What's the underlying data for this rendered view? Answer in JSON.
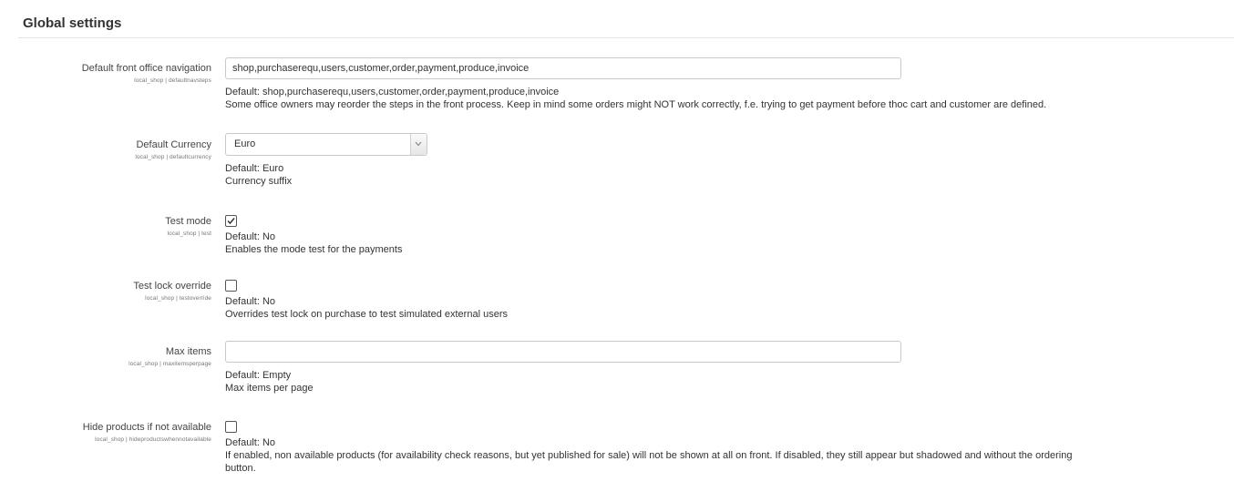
{
  "section": {
    "title": "Global settings"
  },
  "settings": [
    {
      "label": "Default front office navigation",
      "key": "local_shop | defaultnavsteps",
      "value": "shop,purchaserequ,users,customer,order,payment,produce,invoice",
      "default": "Default: shop,purchaserequ,users,customer,order,payment,produce,invoice",
      "description": "Some office owners may reorder the steps in the front process. Keep in mind some orders might NOT work correctly, f.e. trying to get payment before thoc cart and customer are defined."
    },
    {
      "label": "Default Currency",
      "key": "local_shop | defaultcurrency",
      "value": "Euro",
      "default": "Default: Euro",
      "description": "Currency suffix"
    },
    {
      "label": "Test mode",
      "key": "local_shop | test",
      "checked": true,
      "default": "Default: No",
      "description": "Enables the mode test for the payments"
    },
    {
      "label": "Test lock override",
      "key": "local_shop | testoverride",
      "checked": false,
      "default": "Default: No",
      "description": "Overrides test lock on purchase to test simulated external users"
    },
    {
      "label": "Max items",
      "key": "local_shop | maxitemsperpage",
      "value": "",
      "default": "Default: Empty",
      "description": "Max items per page"
    },
    {
      "label": "Hide products if not available",
      "key": "local_shop | hideproductswhennotavailable",
      "checked": false,
      "default": "Default: No",
      "description_line1": "If enabled, non available products (for availability check reasons, but yet published for sale) will not be shown at all on front. If disabled, they still appear but shadowed and without the ordering",
      "description_line2": "button."
    }
  ],
  "icons": {
    "select_arrow": "chevron-down-icon",
    "checkmark": "checkmark-icon"
  },
  "colors": {
    "border": "#c9c9c9",
    "text": "#333333"
  }
}
